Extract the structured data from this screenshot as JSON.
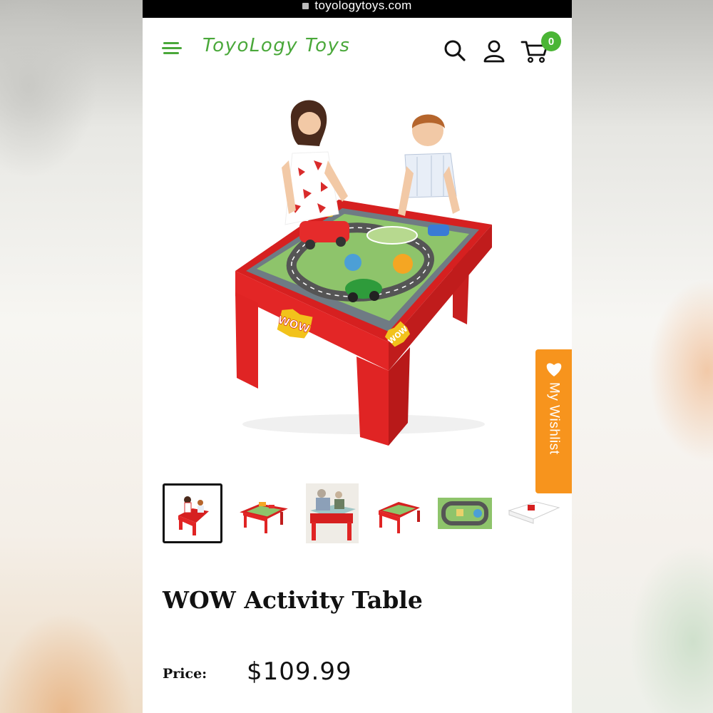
{
  "browser": {
    "url": "toyologytoys.com"
  },
  "header": {
    "brand": "ToyoLogy Toys",
    "cart_count": "0",
    "brand_color": "#4aa83a",
    "badge_color": "#4ab535",
    "icons": [
      "menu-icon",
      "search-icon",
      "user-icon",
      "cart-icon"
    ]
  },
  "gallery": {
    "thumbnail_count": 6,
    "active_index": 0
  },
  "wishlist": {
    "label": "My Wishlist",
    "color": "#f7941d",
    "icon": "heart-icon"
  },
  "product": {
    "title": "WOW Activity Table",
    "price_label": "Price:",
    "price": "$109.99"
  }
}
